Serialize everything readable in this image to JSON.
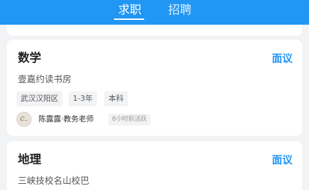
{
  "header": {
    "tabs": [
      {
        "label": "求职",
        "active": true
      },
      {
        "label": "招聘",
        "active": false
      }
    ],
    "background_color": "#2196f3"
  },
  "jobs": [
    {
      "title": "数学",
      "salary": "面议",
      "company": "壹嘉约读书房",
      "tags": [
        "武汉汉阳区",
        "1-3年",
        "本科"
      ],
      "recruiter": {
        "name": "陈露露·教务老师",
        "avatar_text": "C..",
        "active_status": "8小时前活跃"
      }
    },
    {
      "title": "地理",
      "salary": "面议",
      "company": "三峡技校名山校巴"
    }
  ],
  "colors": {
    "accent": "#2196f3",
    "page_background": "#f2f3f5"
  }
}
